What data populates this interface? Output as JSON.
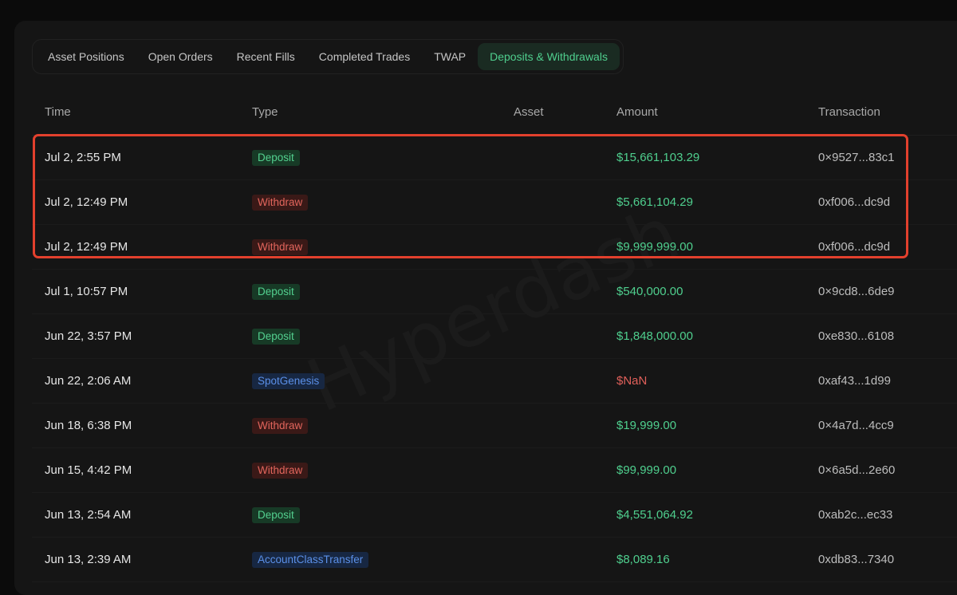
{
  "tabs": [
    {
      "label": "Asset Positions",
      "active": false
    },
    {
      "label": "Open Orders",
      "active": false
    },
    {
      "label": "Recent Fills",
      "active": false
    },
    {
      "label": "Completed Trades",
      "active": false
    },
    {
      "label": "TWAP",
      "active": false
    },
    {
      "label": "Deposits & Withdrawals",
      "active": true
    }
  ],
  "table": {
    "headers": {
      "time": "Time",
      "type": "Type",
      "asset": "Asset",
      "amount": "Amount",
      "transaction": "Transaction"
    },
    "rows": [
      {
        "time": "Jul 2, 2:55 PM",
        "type": "Deposit",
        "asset": "",
        "amount": "$15,661,103.29",
        "amount_status": "positive",
        "transaction": "0×9527...83c1"
      },
      {
        "time": "Jul 2, 12:49 PM",
        "type": "Withdraw",
        "asset": "",
        "amount": "$5,661,104.29",
        "amount_status": "positive",
        "transaction": "0xf006...dc9d"
      },
      {
        "time": "Jul 2, 12:49 PM",
        "type": "Withdraw",
        "asset": "",
        "amount": "$9,999,999.00",
        "amount_status": "positive",
        "transaction": "0xf006...dc9d"
      },
      {
        "time": "Jul 1, 10:57 PM",
        "type": "Deposit",
        "asset": "",
        "amount": "$540,000.00",
        "amount_status": "positive",
        "transaction": "0×9cd8...6de9"
      },
      {
        "time": "Jun 22, 3:57 PM",
        "type": "Deposit",
        "asset": "",
        "amount": "$1,848,000.00",
        "amount_status": "positive",
        "transaction": "0xe830...6108"
      },
      {
        "time": "Jun 22, 2:06 AM",
        "type": "SpotGenesis",
        "asset": "",
        "amount": "$NaN",
        "amount_status": "negative",
        "transaction": "0xaf43...1d99"
      },
      {
        "time": "Jun 18, 6:38 PM",
        "type": "Withdraw",
        "asset": "",
        "amount": "$19,999.00",
        "amount_status": "positive",
        "transaction": "0×4a7d...4cc9"
      },
      {
        "time": "Jun 15, 4:42 PM",
        "type": "Withdraw",
        "asset": "",
        "amount": "$99,999.00",
        "amount_status": "positive",
        "transaction": "0×6a5d...2e60"
      },
      {
        "time": "Jun 13, 2:54 AM",
        "type": "Deposit",
        "asset": "",
        "amount": "$4,551,064.92",
        "amount_status": "positive",
        "transaction": "0xab2c...ec33"
      },
      {
        "time": "Jun 13, 2:39 AM",
        "type": "AccountClassTransfer",
        "asset": "",
        "amount": "$8,089.16",
        "amount_status": "positive",
        "transaction": "0xdb83...7340"
      }
    ]
  },
  "watermark": "Hyperdash",
  "colors": {
    "positive": "#4fcf8e",
    "negative": "#e0605a",
    "highlight_border": "#e2402d",
    "active_tab_bg": "#1a2b22"
  }
}
